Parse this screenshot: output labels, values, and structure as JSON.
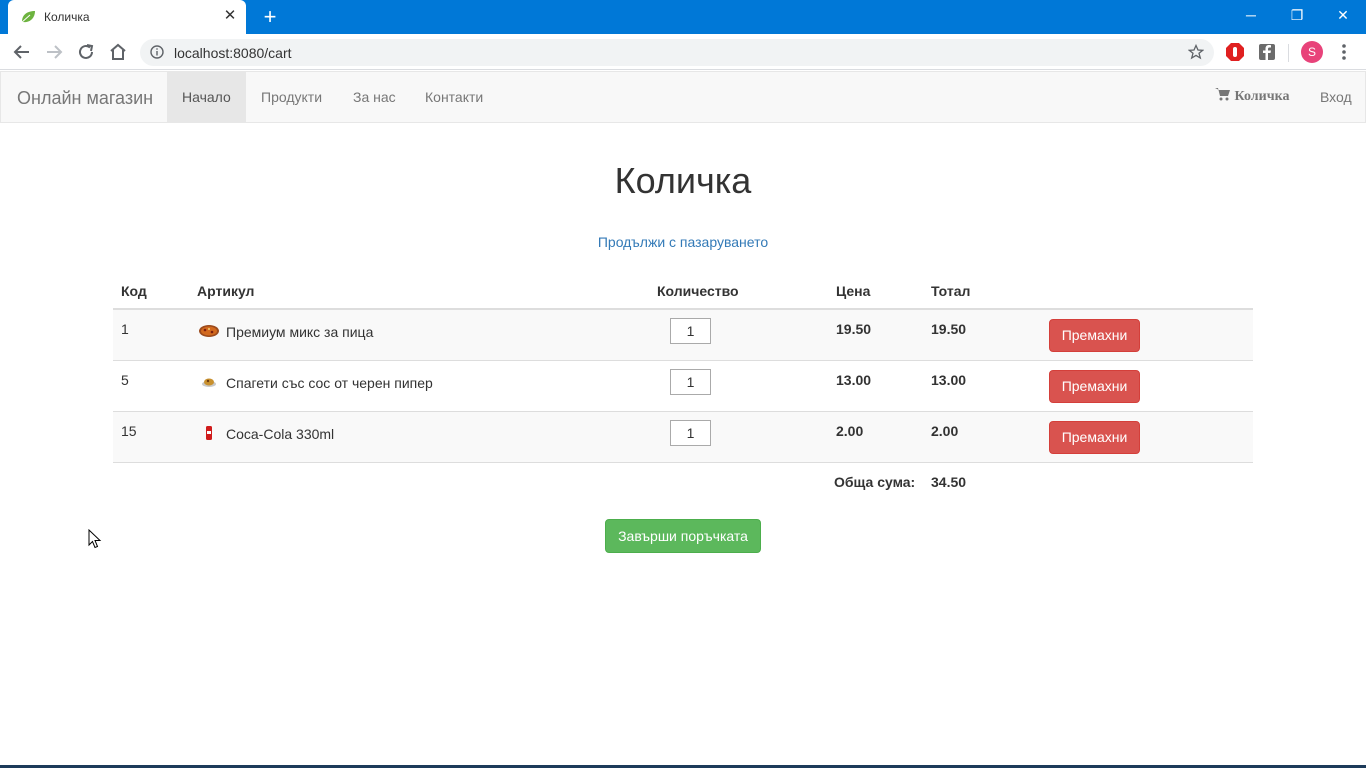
{
  "browser": {
    "tab_title": "Количка",
    "url": "localhost:8080/cart",
    "profile_initial": "S",
    "window_controls": {
      "minimize": "─",
      "restore": "❐",
      "close": "✕"
    }
  },
  "navbar": {
    "brand": "Онлайн магазин",
    "links": [
      "Начало",
      "Продукти",
      "За нас",
      "Контакти"
    ],
    "cart": "Количка",
    "login": "Вход"
  },
  "page": {
    "title": "Количка",
    "continue_link": "Продължи с пазаруването"
  },
  "table": {
    "headers": {
      "code": "Код",
      "item": "Артикул",
      "quantity": "Количество",
      "price": "Цена",
      "total": "Тотал"
    },
    "rows": [
      {
        "code": "1",
        "name": "Премиум микс за пица",
        "qty": "1",
        "price": "19.50",
        "total": "19.50",
        "remove": "Премахни",
        "icon": "pizza-icon"
      },
      {
        "code": "5",
        "name": "Спагети със сос от черен пипер",
        "qty": "1",
        "price": "13.00",
        "total": "13.00",
        "remove": "Премахни",
        "icon": "spaghetti-icon"
      },
      {
        "code": "15",
        "name": "Coca-Cola 330ml",
        "qty": "1",
        "price": "2.00",
        "total": "2.00",
        "remove": "Премахни",
        "icon": "cola-can-icon"
      }
    ],
    "sum_label": "Обща сума:",
    "sum_value": "34.50"
  },
  "checkout_button": "Завърши поръчката",
  "colors": {
    "titlebar": "#0078d7",
    "link": "#337ab7",
    "danger": "#d9534f",
    "success": "#5cb85c"
  }
}
